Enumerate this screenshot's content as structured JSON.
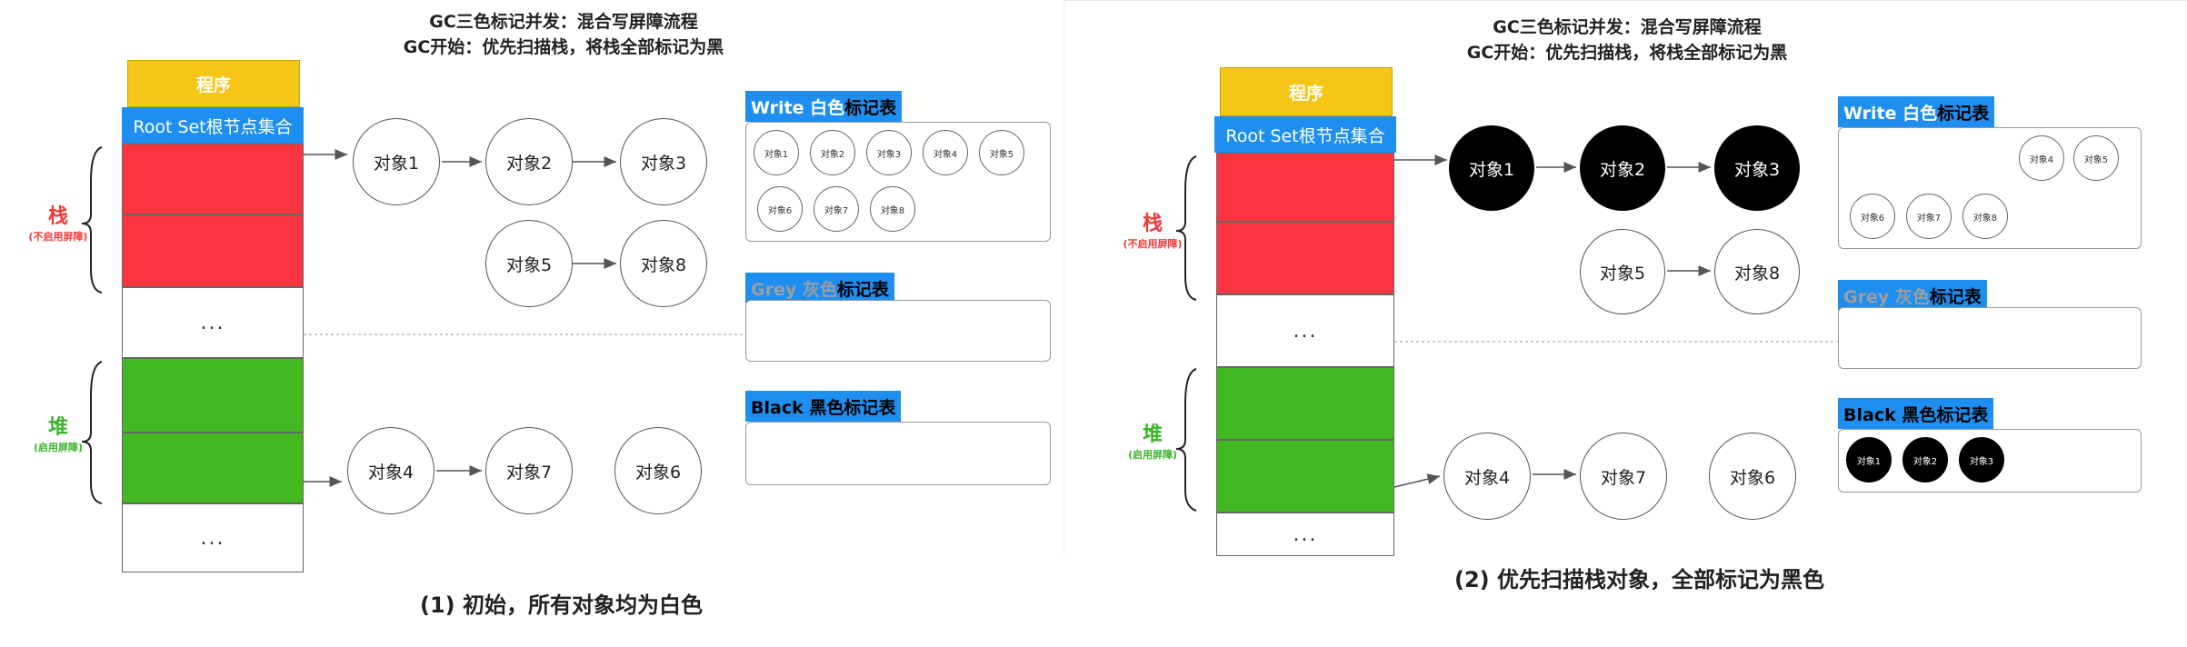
{
  "panels": [
    {
      "title_line1": "GC三色标记并发：混合写屏障流程",
      "title_line2": "GC开始：优先扫描栈，将栈全部标记为黑",
      "program_label": "程序",
      "rootset_label": "Root Set根节点集合",
      "stack_label": "栈",
      "stack_sub": "(不启用屏障)",
      "heap_label": "堆",
      "heap_sub": "(启用屏障)",
      "ellipsis": "...",
      "nodes": {
        "obj1": {
          "label": "对象1",
          "color": "white"
        },
        "obj2": {
          "label": "对象2",
          "color": "white"
        },
        "obj3": {
          "label": "对象3",
          "color": "white"
        },
        "obj5": {
          "label": "对象5",
          "color": "white"
        },
        "obj8": {
          "label": "对象8",
          "color": "white"
        },
        "obj4": {
          "label": "对象4",
          "color": "white"
        },
        "obj7": {
          "label": "对象7",
          "color": "white"
        },
        "obj6": {
          "label": "对象6",
          "color": "white"
        }
      },
      "white_table": {
        "title_en": "Write 白色",
        "title_zh": "标记表",
        "items": [
          "对象1",
          "对象2",
          "对象3",
          "对象4",
          "对象5",
          "对象6",
          "对象7",
          "对象8"
        ]
      },
      "grey_table": {
        "title_en": "Grey 灰色",
        "title_zh": "标记表",
        "items": []
      },
      "black_table": {
        "title_en": "Black 黑色",
        "title_zh": "标记表",
        "items": []
      },
      "caption": "(1) 初始，所有对象均为白色"
    },
    {
      "title_line1": "GC三色标记并发：混合写屏障流程",
      "title_line2": "GC开始：优先扫描栈，将栈全部标记为黑",
      "program_label": "程序",
      "rootset_label": "Root Set根节点集合",
      "stack_label": "栈",
      "stack_sub": "(不启用屏障)",
      "heap_label": "堆",
      "heap_sub": "(启用屏障)",
      "ellipsis": "...",
      "nodes": {
        "obj1": {
          "label": "对象1",
          "color": "black"
        },
        "obj2": {
          "label": "对象2",
          "color": "black"
        },
        "obj3": {
          "label": "对象3",
          "color": "black"
        },
        "obj5": {
          "label": "对象5",
          "color": "white"
        },
        "obj8": {
          "label": "对象8",
          "color": "white"
        },
        "obj4": {
          "label": "对象4",
          "color": "white"
        },
        "obj7": {
          "label": "对象7",
          "color": "white"
        },
        "obj6": {
          "label": "对象6",
          "color": "white"
        }
      },
      "white_table": {
        "title_en": "Write 白色",
        "title_zh": "标记表",
        "items": [
          "对象4",
          "对象5",
          "对象6",
          "对象7",
          "对象8"
        ]
      },
      "grey_table": {
        "title_en": "Grey 灰色",
        "title_zh": "标记表",
        "items": []
      },
      "black_table": {
        "title_en": "Black 黑色",
        "title_zh": "标记表",
        "items": [
          "对象1",
          "对象2",
          "对象3"
        ]
      },
      "caption": "(2) 优先扫描栈对象，全部标记为黑色"
    }
  ],
  "colors": {
    "program": "#f5c518",
    "rootset": "#1e8ff0",
    "stack_block": "#fb343f",
    "heap_block": "#42b821",
    "stack_label": "#f23a3a",
    "heap_label": "#3ab52a"
  }
}
